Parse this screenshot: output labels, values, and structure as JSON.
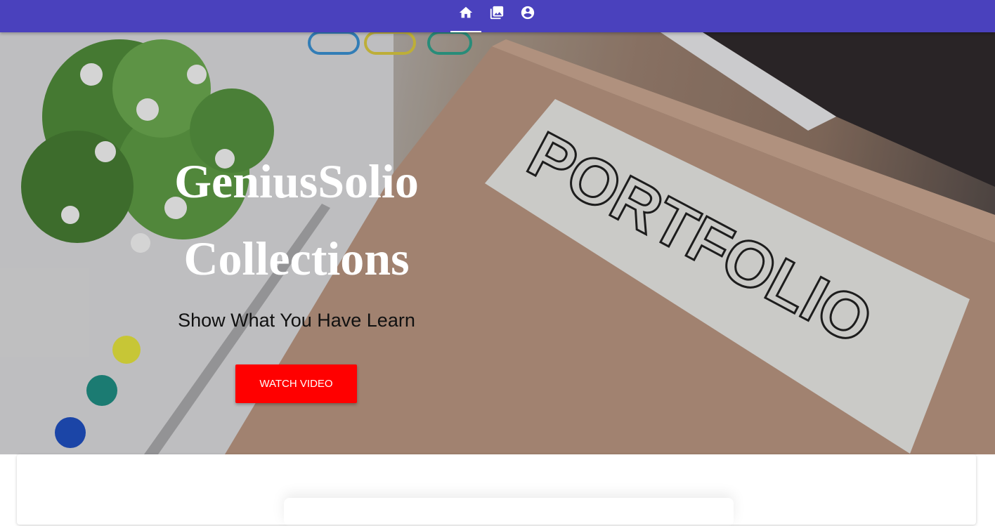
{
  "nav": {
    "tabs": [
      {
        "name": "home",
        "icon": "home-icon",
        "active": true
      },
      {
        "name": "gallery",
        "icon": "photo-library-icon",
        "active": false
      },
      {
        "name": "account",
        "icon": "account-circle-icon",
        "active": false
      }
    ],
    "bar_color": "#4a41bd"
  },
  "hero": {
    "title_line1": "GeniusSolio",
    "title_line2": "Collections",
    "subtitle": "Show What You Have Learn",
    "button_label": "WATCH VIDEO",
    "button_color": "#ff0000",
    "background_text": "PORTFOLIO"
  }
}
